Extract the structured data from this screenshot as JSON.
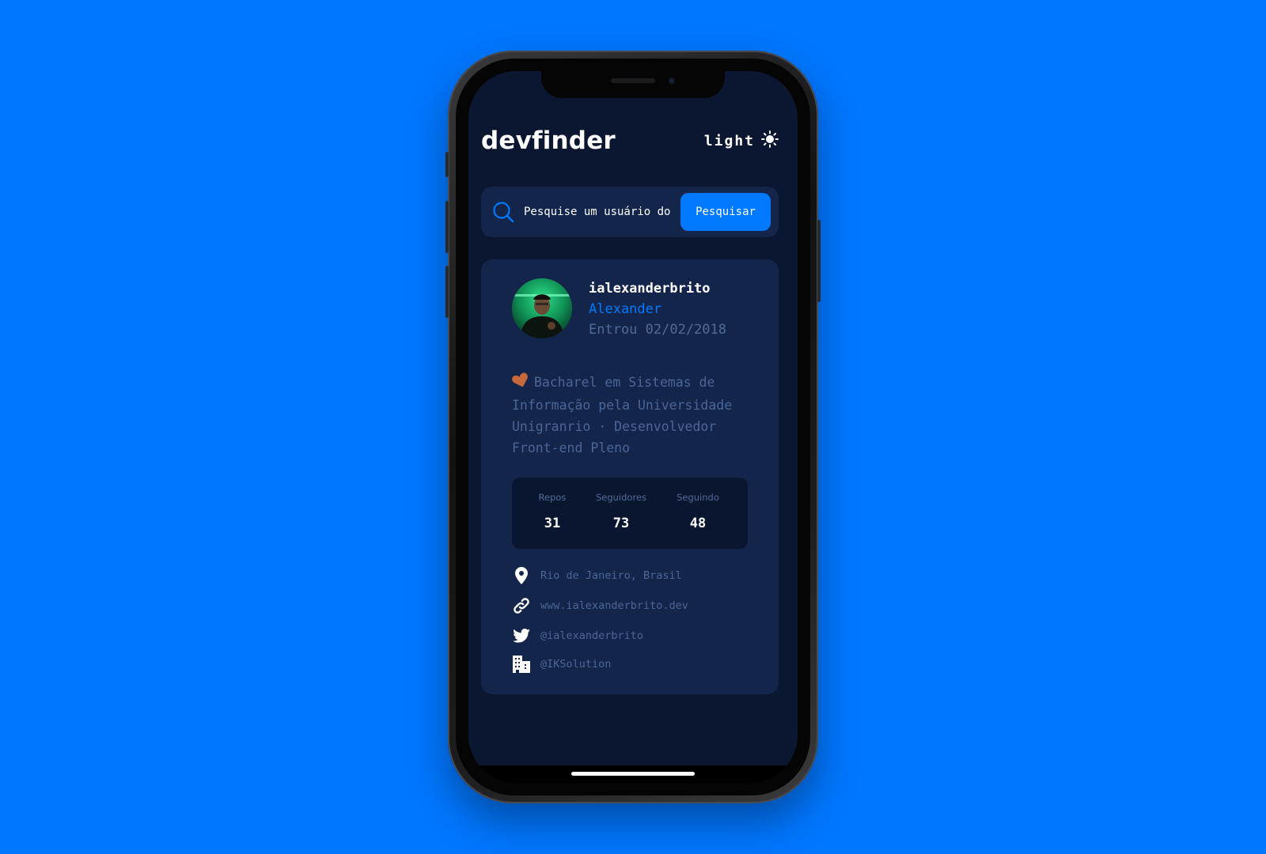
{
  "app": {
    "logo": "devfinder",
    "theme_toggle_label": "light"
  },
  "search": {
    "placeholder": "Pesquise um usuário do GitHub...",
    "button_label": "Pesquisar"
  },
  "profile": {
    "login": "ialexanderbrito",
    "name": "Alexander",
    "joined": "Entrou 02/02/2018",
    "bio": "Bacharel em Sistemas de Informação pela Universidade Unigranrio · Desenvolvedor Front-end Pleno",
    "stats": {
      "repos_label": "Repos",
      "repos_value": "31",
      "followers_label": "Seguidores",
      "followers_value": "73",
      "following_label": "Seguindo",
      "following_value": "48"
    },
    "links": {
      "location": "Rio de Janeiro, Brasil",
      "blog": "www.ialexanderbrito.dev",
      "twitter": "@ialexanderbrito",
      "company": "@IKSolution"
    }
  },
  "icons": {
    "theme": "sun-icon",
    "search": "search-icon",
    "bio_emoji": "heart-icon",
    "location": "location-pin-icon",
    "blog": "link-icon",
    "twitter": "twitter-icon",
    "company": "building-icon"
  },
  "colors": {
    "background": "#0077ff",
    "screen": "#0b1631",
    "card": "#13254a",
    "accent": "#0079ff",
    "muted_text": "#4b6698"
  }
}
